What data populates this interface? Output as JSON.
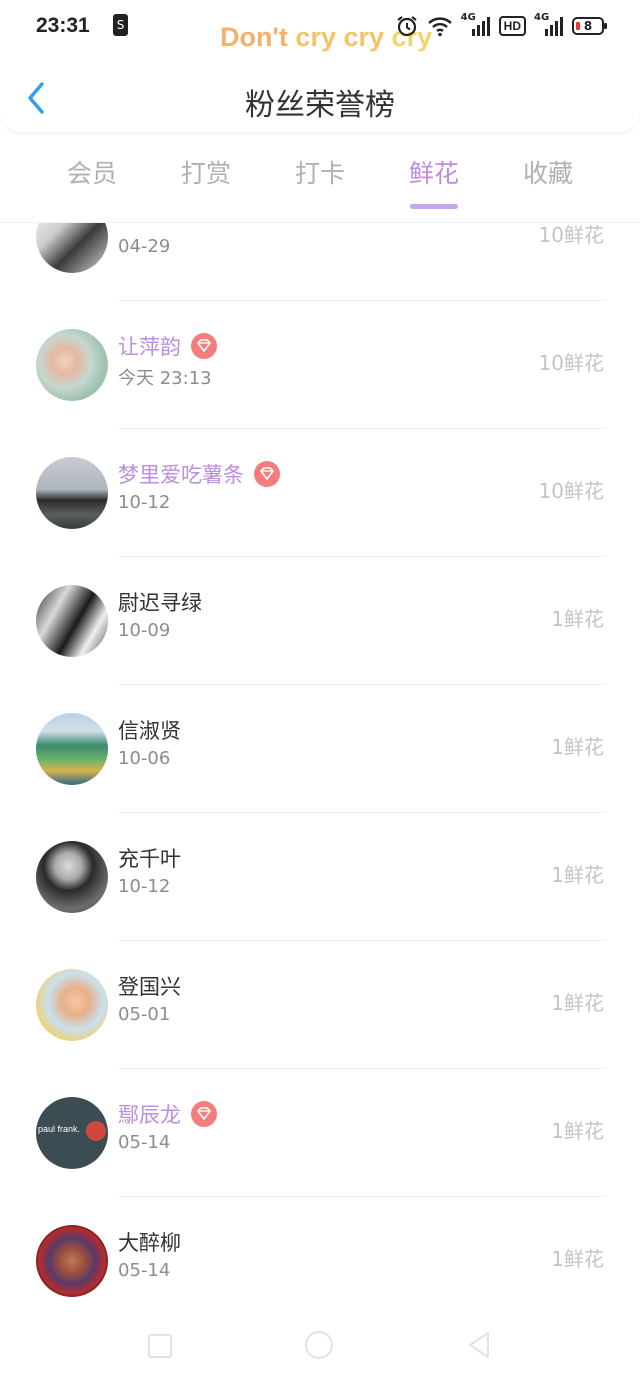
{
  "status_bar": {
    "time": "23:31",
    "notification_icon_label": "S",
    "lyric_words": [
      "Don't",
      "cry",
      "cry",
      "cry"
    ],
    "network_label_1": "4G",
    "hd_label": "HD",
    "network_label_2": "4G",
    "battery_level": "8"
  },
  "header": {
    "title": "粉丝荣誉榜"
  },
  "tabs": [
    {
      "label": "会员",
      "active": false
    },
    {
      "label": "打赏",
      "active": false
    },
    {
      "label": "打卡",
      "active": false
    },
    {
      "label": "鲜花",
      "active": true
    },
    {
      "label": "收藏",
      "active": false
    }
  ],
  "fans": [
    {
      "name": "",
      "date": "04-29",
      "count": "10鲜花",
      "vip": false
    },
    {
      "name": "让萍韵",
      "date": "今天 23:13",
      "count": "10鲜花",
      "vip": true
    },
    {
      "name": "梦里爱吃薯条",
      "date": "10-12",
      "count": "10鲜花",
      "vip": true
    },
    {
      "name": "尉迟寻绿",
      "date": "10-09",
      "count": "1鲜花",
      "vip": false
    },
    {
      "name": "信淑贤",
      "date": "10-06",
      "count": "1鲜花",
      "vip": false
    },
    {
      "name": "充千叶",
      "date": "10-12",
      "count": "1鲜花",
      "vip": false
    },
    {
      "name": "登国兴",
      "date": "05-01",
      "count": "1鲜花",
      "vip": false
    },
    {
      "name": "鄢辰龙",
      "date": "05-14",
      "count": "1鲜花",
      "vip": true
    },
    {
      "name": "大醉柳",
      "date": "05-14",
      "count": "1鲜花",
      "vip": false
    }
  ],
  "avatar_texts": {
    "paul_frank": "paul frank."
  },
  "colors": {
    "accent": "#c08be0",
    "vip_name": "#bc8ee0",
    "gem_badge": "#f47c7c",
    "back_arrow": "#2b9ef3"
  }
}
